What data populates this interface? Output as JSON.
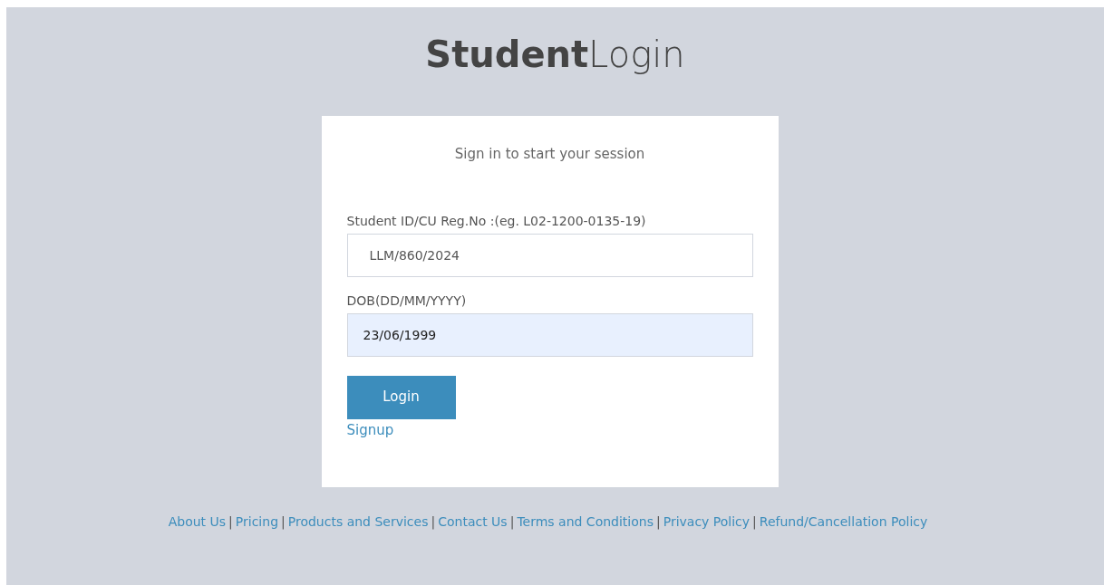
{
  "title": {
    "bold": "Student",
    "light": "Login"
  },
  "login_box": {
    "message": "Sign in to start your session",
    "fields": [
      {
        "label": "Student ID/CU Reg.No :(eg. L02-1200-0135-19)",
        "value": "LLM/860/2024",
        "autofilled": false
      },
      {
        "label": "DOB(DD/MM/YYYY)",
        "value": "23/06/1999",
        "autofilled": true
      }
    ],
    "submit_button": "Login",
    "signup_link": "Signup"
  },
  "footer": {
    "separator": "|",
    "links": [
      "About Us",
      "Pricing",
      "Products and Services",
      "Contact Us",
      "Terms and Conditions",
      "Privacy Policy",
      "Refund/Cancellation Policy"
    ]
  }
}
